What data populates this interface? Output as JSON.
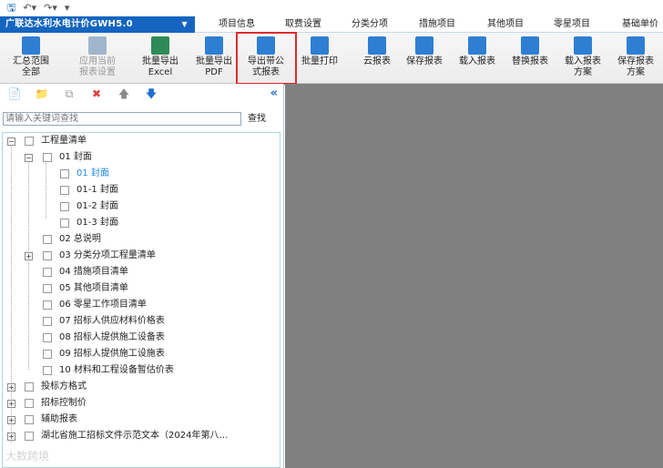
{
  "quick_access": {
    "icons": [
      "save-icon",
      "undo-icon",
      "redo-icon",
      "customize-icon"
    ]
  },
  "app": {
    "title": "广联达水利水电计价GWH5.0"
  },
  "menu": [
    "项目信息",
    "取费设置",
    "分类分项",
    "措施项目",
    "其他项目",
    "零星项目",
    "基础单价"
  ],
  "ribbon": [
    {
      "line1": "汇总范围",
      "line2": "全部",
      "disabled": false,
      "color": "#2e7fd3"
    },
    {
      "line1": "应用当前",
      "line2": "报表设置",
      "disabled": true,
      "color": "#9fb6cc"
    },
    {
      "line1": "批量导出",
      "line2": "Excel",
      "disabled": false,
      "color": "#2e8b57"
    },
    {
      "line1": "批量导出",
      "line2": "PDF",
      "disabled": false,
      "color": "#2e7fd3"
    },
    {
      "line1": "导出带公",
      "line2": "式报表",
      "disabled": false,
      "color": "#2e7fd3"
    },
    {
      "line1": "批量打印",
      "line2": "",
      "disabled": false,
      "color": "#2e7fd3"
    },
    {
      "line1": "云报表",
      "line2": "",
      "disabled": false,
      "color": "#2e7fd3"
    },
    {
      "line1": "保存报表",
      "line2": "",
      "disabled": false,
      "color": "#2e7fd3"
    },
    {
      "line1": "载入报表",
      "line2": "",
      "disabled": false,
      "color": "#2e7fd3"
    },
    {
      "line1": "替换报表",
      "line2": "",
      "disabled": false,
      "color": "#2e7fd3"
    },
    {
      "line1": "载入报表",
      "line2": "方案",
      "disabled": false,
      "color": "#2e7fd3"
    },
    {
      "line1": "保存报表",
      "line2": "方案",
      "disabled": false,
      "color": "#2e7fd3"
    }
  ],
  "panel_toolbar": {
    "icons": [
      "new-report-icon",
      "new-folder-icon",
      "copy-icon",
      "delete-icon",
      "move-up-icon",
      "move-down-icon"
    ],
    "collapse": "«"
  },
  "search": {
    "placeholder": "请输入关键词查找",
    "button": "查找"
  },
  "tree": [
    {
      "label": "工程量清单",
      "level": 0,
      "expand": "−"
    },
    {
      "label": "01 封面",
      "level": 1,
      "expand": "−"
    },
    {
      "label": "01 封面",
      "level": 2,
      "selected": true
    },
    {
      "label": "01-1 封面",
      "level": 2
    },
    {
      "label": "01-2 封面",
      "level": 2
    },
    {
      "label": "01-3 封面",
      "level": 2
    },
    {
      "label": "02 总说明",
      "level": 1
    },
    {
      "label": "03 分类分项工程量清单",
      "level": 1,
      "expand": "+"
    },
    {
      "label": "04 措施项目清单",
      "level": 1
    },
    {
      "label": "05 其他项目清单",
      "level": 1
    },
    {
      "label": "06 零星工作项目清单",
      "level": 1
    },
    {
      "label": "07 招标人供应材料价格表",
      "level": 1
    },
    {
      "label": "08 招标人提供施工设备表",
      "level": 1
    },
    {
      "label": "09 招标人提供施工设施表",
      "level": 1
    },
    {
      "label": "10 材料和工程设备暂估价表",
      "level": 1
    },
    {
      "label": "投标方格式",
      "level": 0,
      "expand": "+"
    },
    {
      "label": "招标控制价",
      "level": 0,
      "expand": "+"
    },
    {
      "label": "辅助报表",
      "level": 0,
      "expand": "+"
    },
    {
      "label": "湖北省施工招标文件示范文本（2024年第八…",
      "level": 0,
      "expand": "+"
    }
  ],
  "watermark": "大数跨境"
}
